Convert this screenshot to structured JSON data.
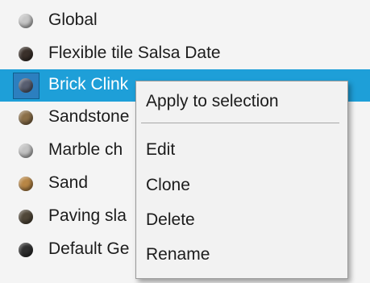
{
  "materials": [
    {
      "label": "Global",
      "swatch": "#c6c6c6"
    },
    {
      "label": "Flexible tile Salsa Date",
      "swatch": "#3a302a"
    },
    {
      "label": "Brick Clink",
      "swatch": "#585e70",
      "selected": true
    },
    {
      "label": "Sandstone",
      "swatch": "#8b6f48"
    },
    {
      "label": "Marble ch",
      "swatch": "#c2c2c2"
    },
    {
      "label": "Sand",
      "swatch": "#b88645"
    },
    {
      "label": "Paving sla",
      "swatch": "#504738"
    },
    {
      "label": "Default Ge",
      "swatch": "#2e2e2e"
    }
  ],
  "context_menu": {
    "items": [
      "Apply to selection",
      "Edit",
      "Clone",
      "Delete",
      "Rename"
    ]
  },
  "colors": {
    "selection": "#1e9fd8",
    "list_bg": "#f4f4f4",
    "menu_bg": "#f2f2f2"
  }
}
